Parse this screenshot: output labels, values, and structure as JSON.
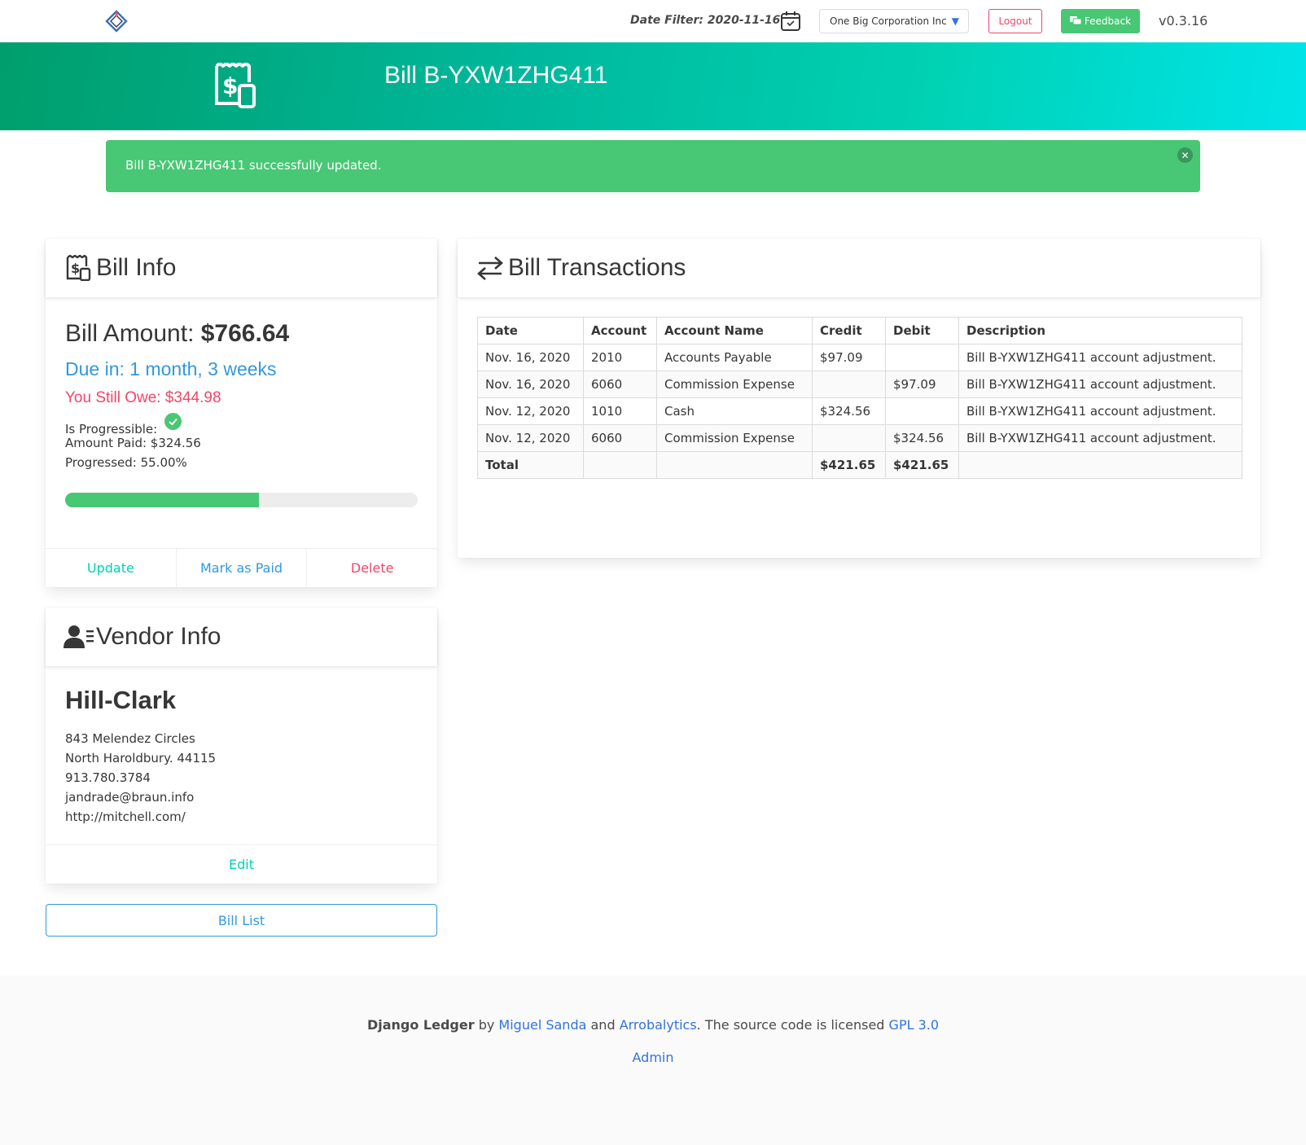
{
  "navbar": {
    "logo_icon": "django-ledger-logo",
    "date_filter": "Date Filter: 2020-11-16",
    "calendar_icon": "calendar-check-icon",
    "entity": "One Big Corporation Inc",
    "logout": "Logout",
    "feedback": "Feedback",
    "version": "v0.3.16"
  },
  "hero": {
    "icon": "receipt-dollar-icon",
    "title": "Bill B-YXW1ZHG411"
  },
  "notification": {
    "message": "Bill B-YXW1ZHG411 successfully updated.",
    "color": "#48c774"
  },
  "bill_info": {
    "title": "Bill Info",
    "amount_label": "Bill Amount: ",
    "amount_value": "$766.64",
    "due": "Due in: 1 month, 3 weeks",
    "owe": "You Still Owe: $344.98",
    "progressible_label": "Is Progressible:",
    "amount_paid": "Amount Paid: $324.56",
    "progressed": "Progressed: 55.00%",
    "progress_fraction": 0.55,
    "actions": {
      "update": "Update",
      "mark_paid": "Mark as Paid",
      "delete": "Delete"
    }
  },
  "vendor_info": {
    "title": "Vendor Info",
    "name": "Hill-Clark",
    "address1": "843 Melendez Circles",
    "address2": "North Haroldbury. 44115",
    "phone": "913.780.3784",
    "email": "jandrade@braun.info",
    "website": "http://mitchell.com/",
    "edit": "Edit"
  },
  "bill_list_button": "Bill List",
  "transactions": {
    "title": "Bill Transactions",
    "columns": [
      "Date",
      "Account",
      "Account Name",
      "Credit",
      "Debit",
      "Description"
    ],
    "rows": [
      [
        "Nov. 16, 2020",
        "2010",
        "Accounts Payable",
        "$97.09",
        "",
        "Bill B-YXW1ZHG411 account adjustment."
      ],
      [
        "Nov. 16, 2020",
        "6060",
        "Commission Expense",
        "",
        "$97.09",
        "Bill B-YXW1ZHG411 account adjustment."
      ],
      [
        "Nov. 12, 2020",
        "1010",
        "Cash",
        "$324.56",
        "",
        "Bill B-YXW1ZHG411 account adjustment."
      ],
      [
        "Nov. 12, 2020",
        "6060",
        "Commission Expense",
        "",
        "$324.56",
        "Bill B-YXW1ZHG411 account adjustment."
      ]
    ],
    "total": [
      "Total",
      "",
      "",
      "$421.65",
      "$421.65",
      ""
    ]
  },
  "footer": {
    "brand": "Django Ledger",
    "by": " by ",
    "author": "Miguel Sanda",
    "and": " and ",
    "company": "Arrobalytics",
    "license_text": ". The source code is licensed ",
    "license": "GPL 3.0",
    "admin": "Admin"
  },
  "colors": {
    "primary": "#00d1b2",
    "success": "#48c774",
    "info": "#3298dc",
    "danger": "#f14668",
    "link": "#3273dc"
  }
}
